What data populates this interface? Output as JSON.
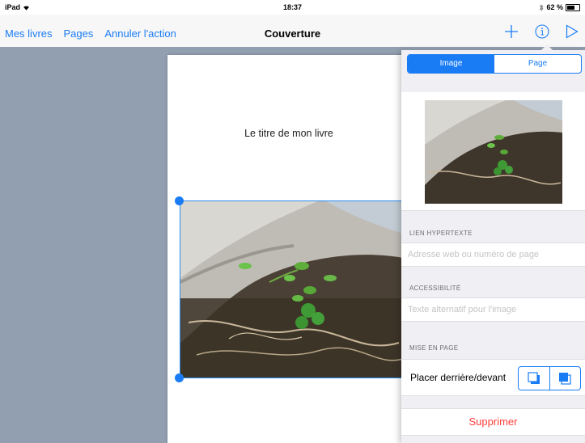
{
  "status_bar": {
    "device": "iPad",
    "time": "18:37",
    "battery": "62 %",
    "battery_level": 0.62
  },
  "nav": {
    "links": [
      "Mes livres",
      "Pages",
      "Annuler l'action"
    ],
    "title": "Couverture",
    "accent": "#1a7cf5"
  },
  "page": {
    "book_title": "Le titre de mon livre"
  },
  "inspector": {
    "tabs": [
      {
        "label": "Image",
        "selected": true
      },
      {
        "label": "Page",
        "selected": false
      }
    ],
    "hyperlink": {
      "label": "LIEN HYPERTEXTE",
      "placeholder": "Adresse web ou numéro de page"
    },
    "accessibility": {
      "label": "ACCESSIBILITÉ",
      "placeholder": "Texte alternatif pour l'image"
    },
    "layout": {
      "label": "MISE EN PAGE",
      "row_label": "Placer derrière/devant"
    },
    "delete_label": "Supprimer",
    "delete_color": "#fc3d39"
  }
}
